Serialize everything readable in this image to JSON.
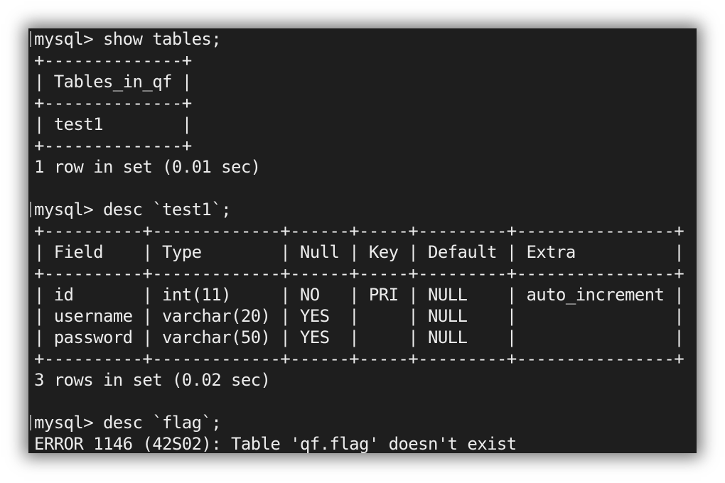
{
  "terminal": {
    "lines": [
      {
        "kind": "prompt",
        "text": "mysql> show tables;"
      },
      {
        "kind": "output",
        "text": "+--------------+"
      },
      {
        "kind": "output",
        "text": "| Tables_in_qf |"
      },
      {
        "kind": "output",
        "text": "+--------------+"
      },
      {
        "kind": "output",
        "text": "| test1        |"
      },
      {
        "kind": "output",
        "text": "+--------------+"
      },
      {
        "kind": "output",
        "text": "1 row in set (0.01 sec)"
      },
      {
        "kind": "blank",
        "text": ""
      },
      {
        "kind": "prompt",
        "text": "mysql> desc `test1`;"
      },
      {
        "kind": "output",
        "text": "+----------+-------------+------+-----+---------+----------------+"
      },
      {
        "kind": "output",
        "text": "| Field    | Type        | Null | Key | Default | Extra          |"
      },
      {
        "kind": "output",
        "text": "+----------+-------------+------+-----+---------+----------------+"
      },
      {
        "kind": "output",
        "text": "| id       | int(11)     | NO   | PRI | NULL    | auto_increment |"
      },
      {
        "kind": "output",
        "text": "| username | varchar(20) | YES  |     | NULL    |                |"
      },
      {
        "kind": "output",
        "text": "| password | varchar(50) | YES  |     | NULL    |                |"
      },
      {
        "kind": "output",
        "text": "+----------+-------------+------+-----+---------+----------------+"
      },
      {
        "kind": "output",
        "text": "3 rows in set (0.02 sec)"
      },
      {
        "kind": "blank",
        "text": ""
      },
      {
        "kind": "prompt",
        "text": "mysql> desc `flag`;"
      },
      {
        "kind": "output",
        "text": "ERROR 1146 (42S02): Table 'qf.flag' doesn't exist"
      }
    ]
  },
  "colors": {
    "background": "#1e1e1e",
    "text": "#ececec",
    "page": "#ffffff"
  }
}
